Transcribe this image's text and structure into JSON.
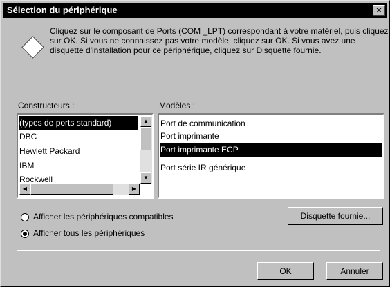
{
  "title": "Sélection du périphérique",
  "close_glyph": "✕",
  "instructions": "Cliquez sur le composant de Ports (COM _LPT) correspondant à votre matériel, puis cliquez sur OK. Si vous ne connaissez pas votre modèle, cliquez sur OK. Si vous avez une disquette d'installation pour ce périphérique, cliquez sur Disquette fournie.",
  "manufacturers": {
    "label": "Constructeurs :",
    "items": [
      "(types de ports standard)",
      "DBC",
      "Hewlett Packard",
      "IBM",
      "Rockwell"
    ],
    "selected_index": 0
  },
  "models": {
    "label": "Modèles :",
    "items": [
      "Port de communication",
      "Port imprimante",
      "Port imprimante  ECP",
      "Port série IR générique"
    ],
    "selected_index": 2
  },
  "options": {
    "show_compatible": "Afficher les périphériques compatibles",
    "show_all": "Afficher tous les périphériques",
    "selected": "show_all"
  },
  "buttons": {
    "have_disk": "Disquette fournie...",
    "ok": "OK",
    "cancel": "Annuler"
  },
  "icons": {
    "dialog": "diamond-icon",
    "scroll_up": "arrow-up-icon",
    "scroll_down": "arrow-down-icon",
    "scroll_left": "arrow-left-icon",
    "scroll_right": "arrow-right-icon"
  },
  "colors": {
    "face": "#c0c0c0",
    "titlebar": "#000000",
    "selection": "#000000"
  }
}
